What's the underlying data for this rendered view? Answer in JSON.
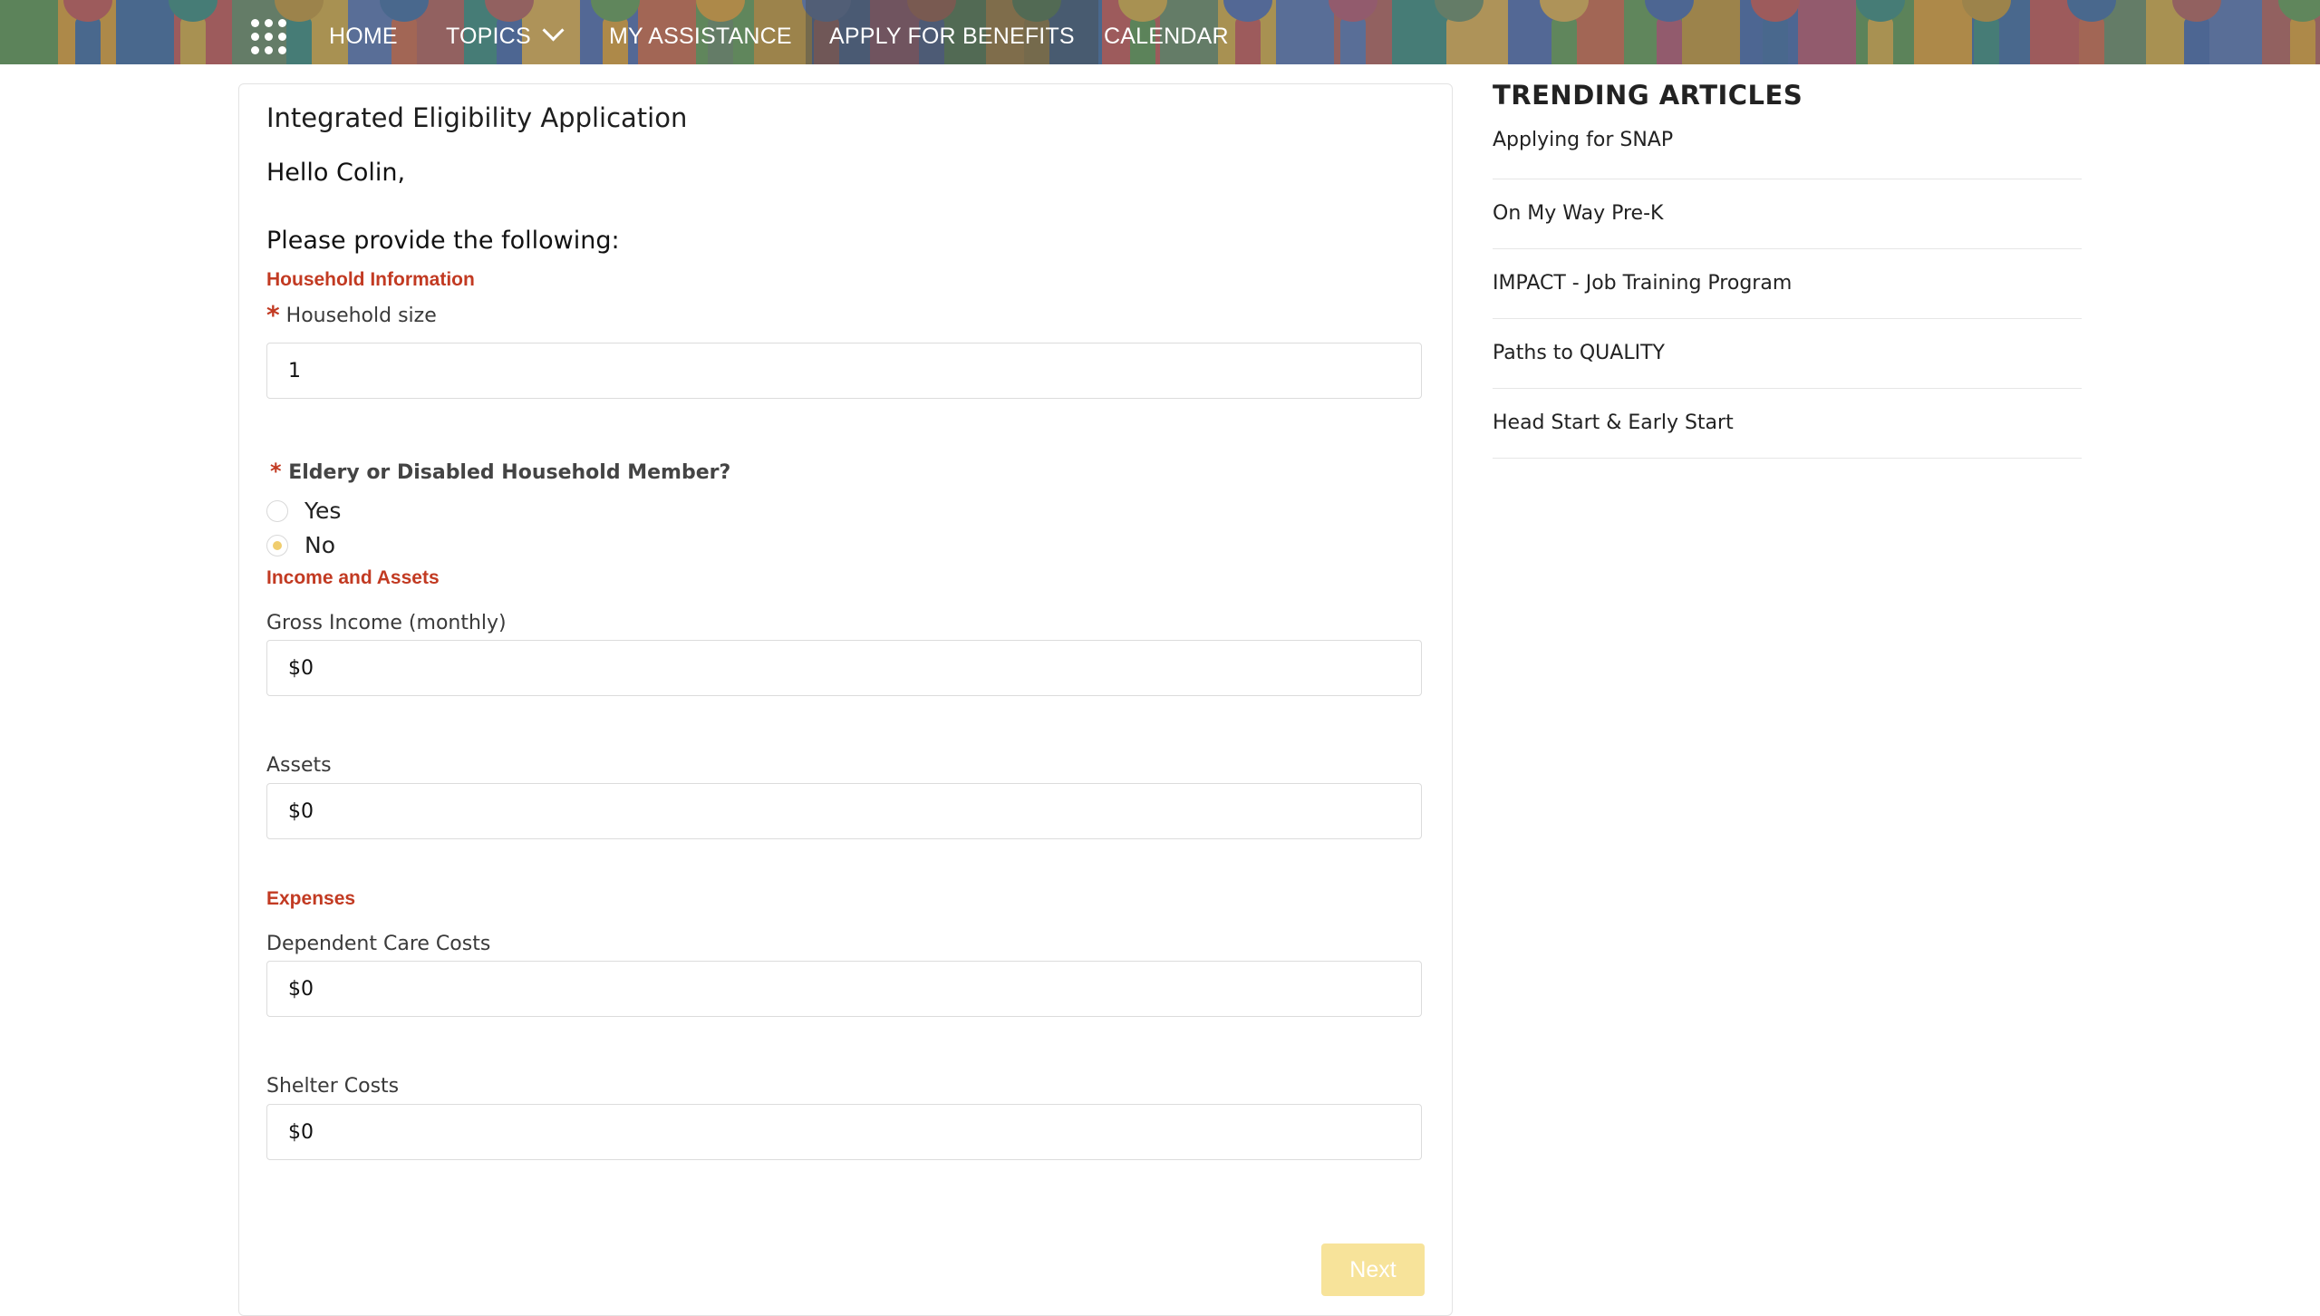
{
  "header": {
    "stripe_colors": [
      "#5e9a56",
      "#e0a33a",
      "#3f6fa8",
      "#c75a5a",
      "#6b8e6b",
      "#d8b04a",
      "#5a78b8",
      "#b5635f",
      "#3b8f83",
      "#e2b355",
      "#4f6fb5",
      "#cf6b4e",
      "#649e5a",
      "#c59a3e",
      "#466bb0",
      "#b55a74"
    ],
    "nav": {
      "home": "HOME",
      "topics": "TOPICS",
      "my_assistance": "MY ASSISTANCE",
      "apply": "APPLY FOR BENEFITS",
      "calendar": "CALENDAR"
    }
  },
  "form": {
    "title": "Integrated Eligibility Application",
    "greeting": "Hello Colin,",
    "prompt": "Please provide the following:",
    "required_mark": "*",
    "sections": {
      "household": "Household Information",
      "income": "Income and Assets",
      "expenses": "Expenses"
    },
    "household_size": {
      "label": "Household size",
      "value": "1"
    },
    "elderly_question": {
      "label": "Eldery or Disabled Household Member?",
      "options": [
        "Yes",
        "No"
      ],
      "selected": "No"
    },
    "gross_income": {
      "label": "Gross Income (monthly)",
      "value": "$0"
    },
    "assets": {
      "label": "Assets",
      "value": "$0"
    },
    "dependent_care": {
      "label": "Dependent Care Costs",
      "value": "$0"
    },
    "shelter": {
      "label": "Shelter Costs",
      "value": "$0"
    },
    "next_label": "Next"
  },
  "sidebar": {
    "title": "TRENDING ARTICLES",
    "articles": [
      "Applying for SNAP",
      "On My Way Pre-K",
      "IMPACT - Job Training Program",
      "Paths to QUALITY",
      "Head Start & Early Start"
    ]
  }
}
